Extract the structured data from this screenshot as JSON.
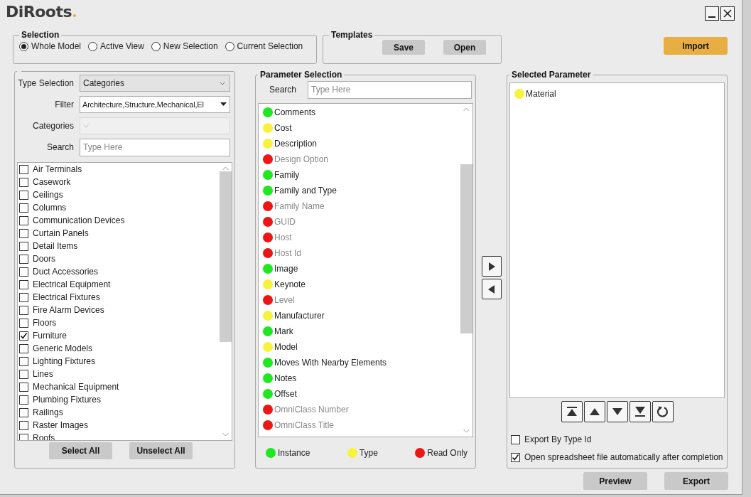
{
  "logo": "DiRoots",
  "selection": {
    "title": "Selection",
    "options": [
      {
        "label": "Whole Model",
        "selected": true
      },
      {
        "label": "Active View",
        "selected": false
      },
      {
        "label": "New Selection",
        "selected": false
      },
      {
        "label": "Current Selection",
        "selected": false
      }
    ]
  },
  "templates": {
    "title": "Templates",
    "buttons": [
      "Save",
      "Open"
    ]
  },
  "import_button": "Import",
  "categories_panel": {
    "fields": [
      {
        "label": "Type Selection",
        "kind": "combo",
        "value": "Categories",
        "disabled": false
      },
      {
        "label": "Filter",
        "kind": "dropdown",
        "value": "Architecture,Structure,Mechanical,El",
        "disabled": false
      },
      {
        "label": "Categories",
        "kind": "combo",
        "disabled": true
      },
      {
        "label": "Search",
        "kind": "search",
        "placeholder": "Type Here"
      }
    ],
    "items": [
      {
        "label": "Air Terminals",
        "checked": false
      },
      {
        "label": "Casework",
        "checked": false
      },
      {
        "label": "Ceilings",
        "checked": false
      },
      {
        "label": "Columns",
        "checked": false
      },
      {
        "label": "Communication Devices",
        "checked": false
      },
      {
        "label": "Curtain Panels",
        "checked": false
      },
      {
        "label": "Detail Items",
        "checked": false
      },
      {
        "label": "Doors",
        "checked": false
      },
      {
        "label": "Duct Accessories",
        "checked": false
      },
      {
        "label": "Electrical Equipment",
        "checked": false
      },
      {
        "label": "Electrical Fixtures",
        "checked": false
      },
      {
        "label": "Fire Alarm Devices",
        "checked": false
      },
      {
        "label": "Floors",
        "checked": false
      },
      {
        "label": "Furniture",
        "checked": true
      },
      {
        "label": "Generic Models",
        "checked": false
      },
      {
        "label": "Lighting Fixtures",
        "checked": false
      },
      {
        "label": "Lines",
        "checked": false
      },
      {
        "label": "Mechanical Equipment",
        "checked": false
      },
      {
        "label": "Plumbing Fixtures",
        "checked": false
      },
      {
        "label": "Railings",
        "checked": false
      },
      {
        "label": "Raster Images",
        "checked": false
      },
      {
        "label": "Roofs",
        "checked": false
      }
    ],
    "buttons": [
      "Select All",
      "Unselect All"
    ]
  },
  "parameter_panel": {
    "title": "Parameter Selection",
    "search_label": "Search",
    "search_placeholder": "Type Here",
    "items": [
      {
        "label": "Comments",
        "color": "#1fe81f",
        "disabled": false
      },
      {
        "label": "Cost",
        "color": "#f7f23c",
        "disabled": false
      },
      {
        "label": "Description",
        "color": "#f7f23c",
        "disabled": false
      },
      {
        "label": "Design Option",
        "color": "#ee1515",
        "disabled": true
      },
      {
        "label": "Family",
        "color": "#1fe81f",
        "disabled": false
      },
      {
        "label": "Family and Type",
        "color": "#1fe81f",
        "disabled": false
      },
      {
        "label": "Family Name",
        "color": "#ee1515",
        "disabled": true
      },
      {
        "label": "GUID",
        "color": "#ee1515",
        "disabled": true
      },
      {
        "label": "Host",
        "color": "#ee1515",
        "disabled": true
      },
      {
        "label": "Host Id",
        "color": "#ee1515",
        "disabled": true
      },
      {
        "label": "Image",
        "color": "#1fe81f",
        "disabled": false
      },
      {
        "label": "Keynote",
        "color": "#f7f23c",
        "disabled": false
      },
      {
        "label": "Level",
        "color": "#ee1515",
        "disabled": true
      },
      {
        "label": "Manufacturer",
        "color": "#f7f23c",
        "disabled": false
      },
      {
        "label": "Mark",
        "color": "#1fe81f",
        "disabled": false
      },
      {
        "label": "Model",
        "color": "#f7f23c",
        "disabled": false
      },
      {
        "label": "Moves With Nearby Elements",
        "color": "#1fe81f",
        "disabled": false
      },
      {
        "label": "Notes",
        "color": "#1fe81f",
        "disabled": false
      },
      {
        "label": "Offset",
        "color": "#1fe81f",
        "disabled": false
      },
      {
        "label": "OmniClass Number",
        "color": "#ee1515",
        "disabled": true
      },
      {
        "label": "OmniClass Title",
        "color": "#ee1515",
        "disabled": true
      }
    ],
    "legend": [
      {
        "label": "Instance",
        "color": "#1fe81f"
      },
      {
        "label": "Type",
        "color": "#f7f23c"
      },
      {
        "label": "Read Only",
        "color": "#ee1515"
      }
    ]
  },
  "selected_panel": {
    "title": "Selected Parameter",
    "items": [
      {
        "label": "Material",
        "color": "#f7f23c"
      }
    ],
    "options": [
      {
        "label": "Export By Type Id",
        "checked": false
      },
      {
        "label": "Open spreadsheet file automatically after completion",
        "checked": true
      }
    ]
  },
  "actions": [
    "Preview",
    "Export"
  ]
}
